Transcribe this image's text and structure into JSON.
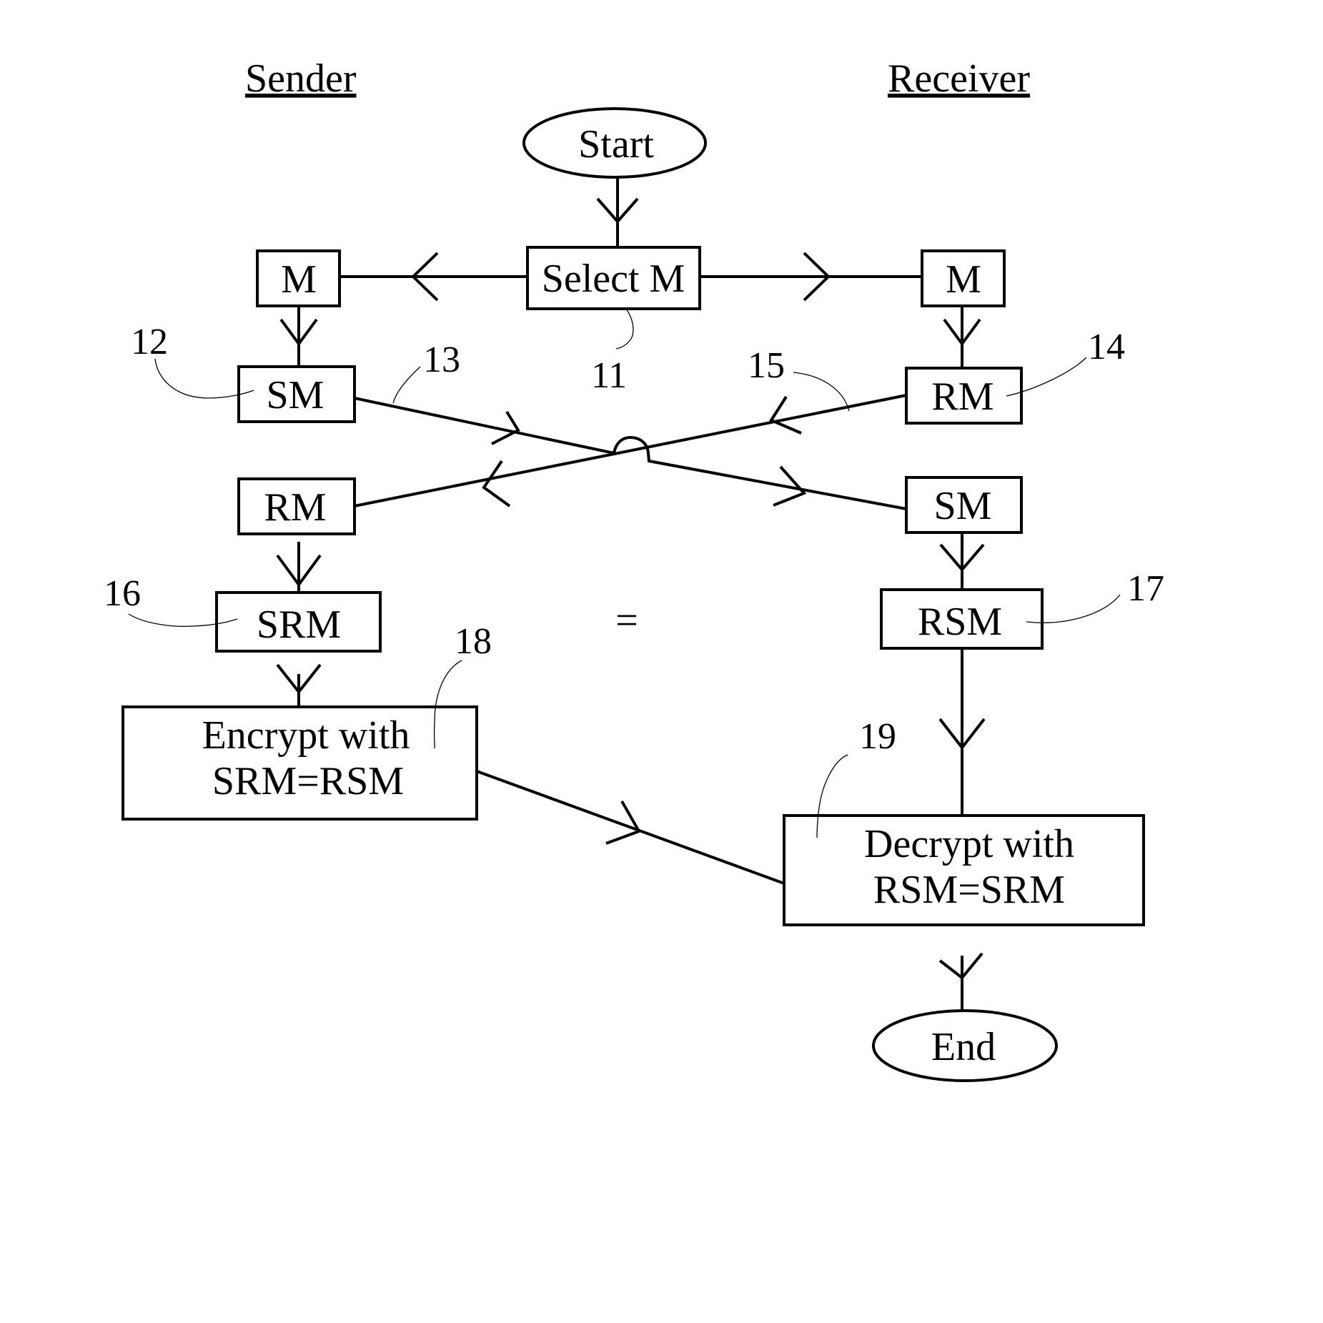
{
  "diagram": {
    "type": "flowchart",
    "lanes": {
      "sender": "Sender",
      "receiver": "Receiver"
    },
    "nodes": {
      "start": {
        "label": "Start",
        "shape": "ellipse"
      },
      "select_m": {
        "label": "Select M",
        "ref": "11"
      },
      "sender_m": {
        "label": "M"
      },
      "receiver_m": {
        "label": "M"
      },
      "sender_sm": {
        "label": "SM",
        "ref": "12"
      },
      "receiver_rm": {
        "label": "RM",
        "ref": "14"
      },
      "sender_rm": {
        "label": "RM"
      },
      "receiver_sm": {
        "label": "SM"
      },
      "sender_srm": {
        "label": "SRM",
        "ref": "16"
      },
      "receiver_rsm": {
        "label": "RSM",
        "ref": "17"
      },
      "encrypt": {
        "line1": "Encrypt with",
        "line2": "SRM=RSM",
        "ref": "18"
      },
      "decrypt": {
        "line1": "Decrypt with",
        "line2": "RSM=SRM",
        "ref": "19"
      },
      "end": {
        "label": "End",
        "shape": "ellipse"
      }
    },
    "transfer_refs": {
      "sm_to_receiver": "13",
      "rm_to_sender": "15"
    },
    "equality_symbol": "=",
    "edges": [
      {
        "from": "start",
        "to": "select_m"
      },
      {
        "from": "select_m",
        "to": "sender_m"
      },
      {
        "from": "select_m",
        "to": "receiver_m"
      },
      {
        "from": "sender_m",
        "to": "sender_sm"
      },
      {
        "from": "receiver_m",
        "to": "receiver_rm"
      },
      {
        "from": "sender_sm",
        "to": "receiver_sm"
      },
      {
        "from": "receiver_rm",
        "to": "sender_rm"
      },
      {
        "from": "sender_rm",
        "to": "sender_srm"
      },
      {
        "from": "receiver_sm",
        "to": "receiver_rsm"
      },
      {
        "from": "sender_srm",
        "to": "encrypt"
      },
      {
        "from": "receiver_rsm",
        "to": "decrypt"
      },
      {
        "from": "encrypt",
        "to": "decrypt"
      },
      {
        "from": "decrypt",
        "to": "end"
      }
    ]
  }
}
